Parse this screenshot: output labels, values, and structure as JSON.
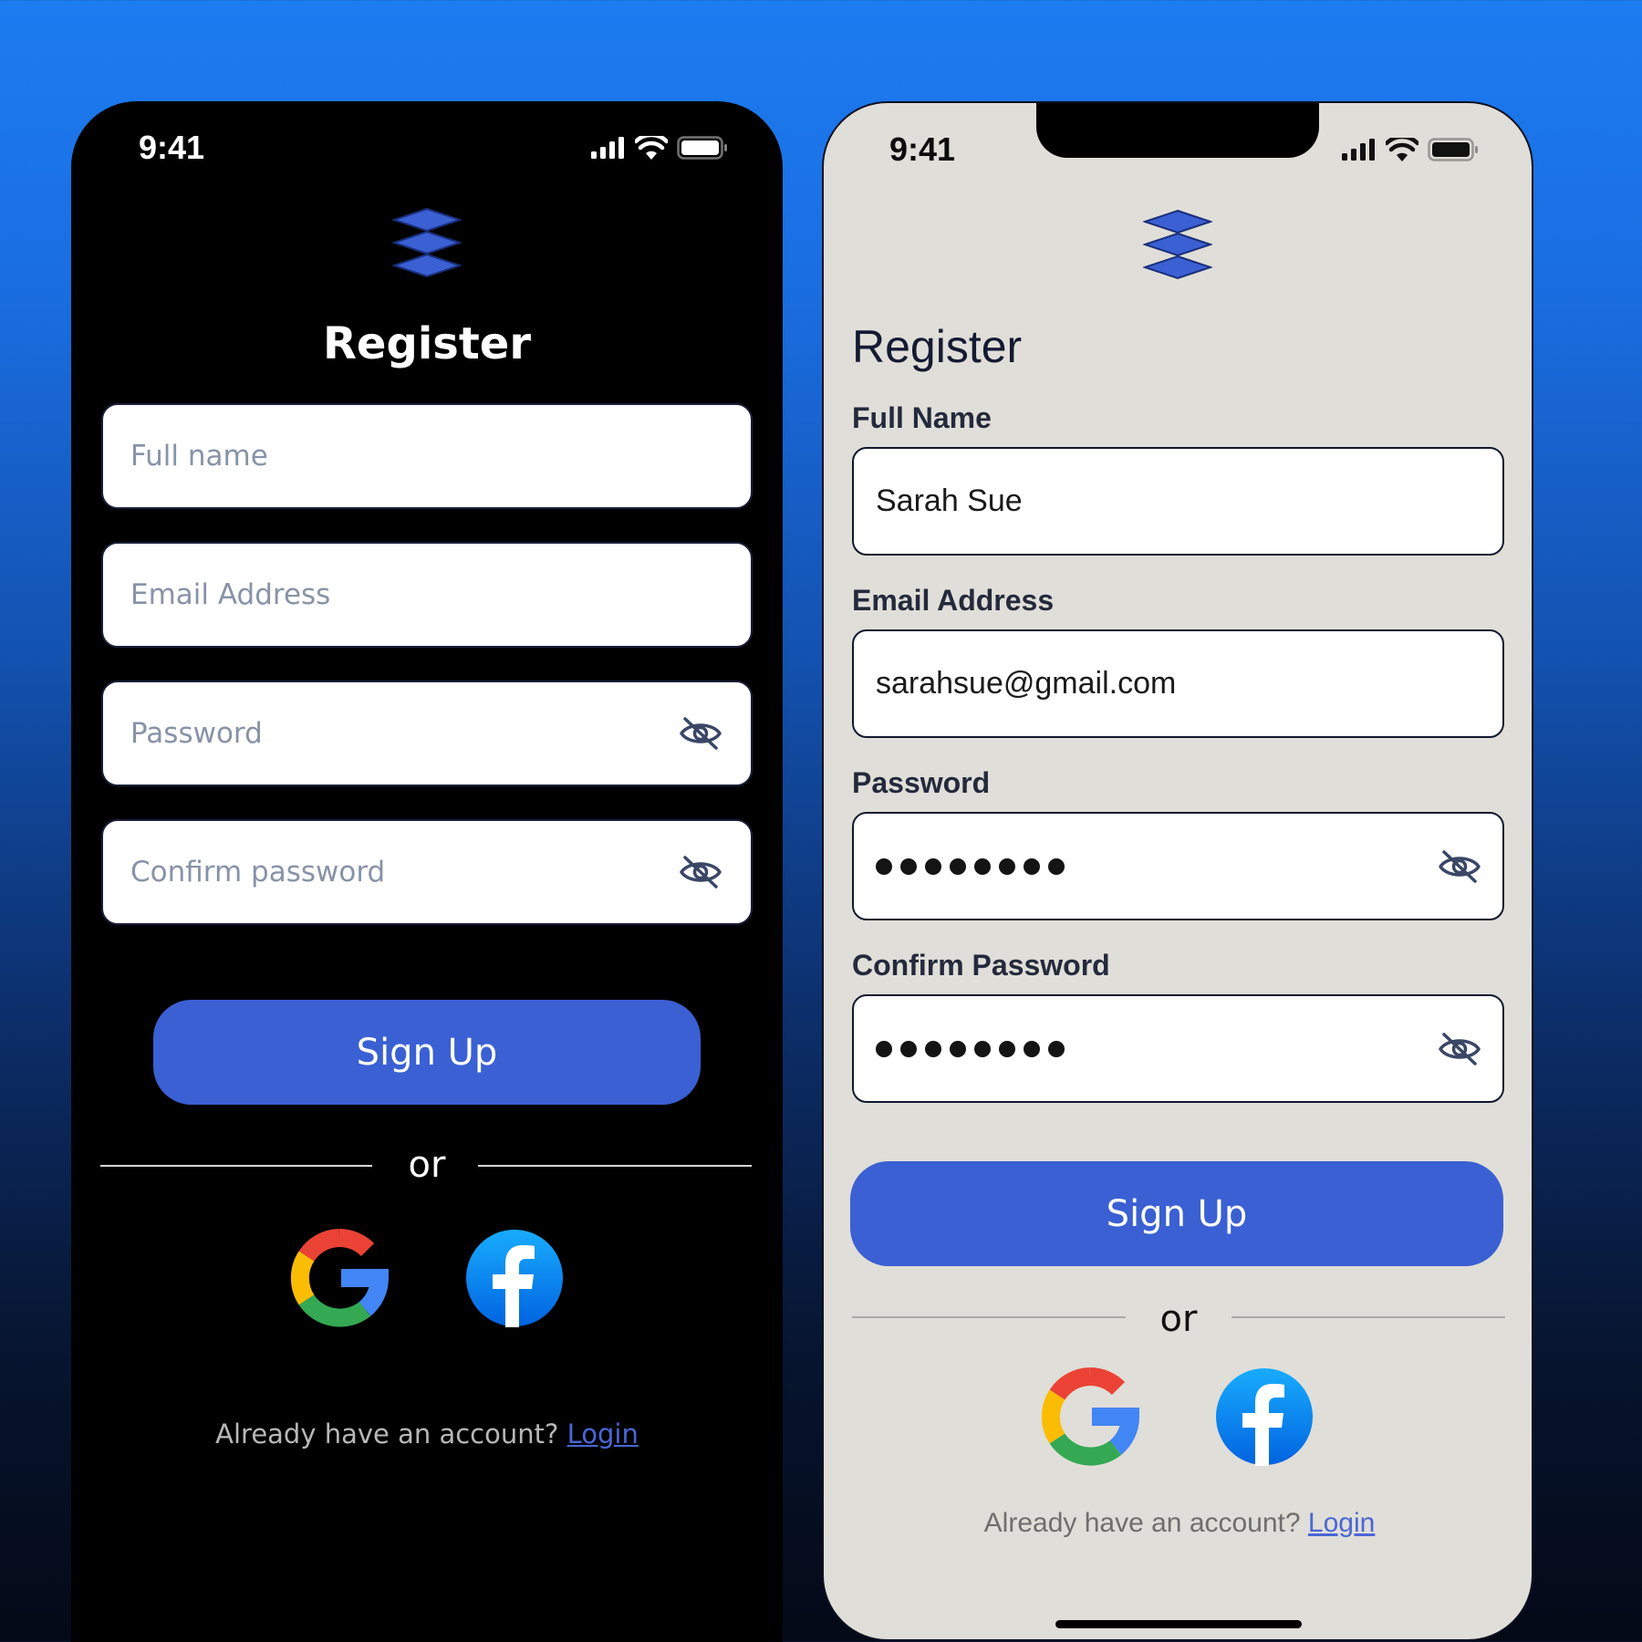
{
  "colors": {
    "accent": "#3a60d3",
    "dark_bg": "#000000",
    "light_bg": "#e0ded8",
    "link": "#4a66d6",
    "placeholder": "#8793a7"
  },
  "status_bar": {
    "time": "9:41",
    "icons": [
      "signal-icon",
      "wifi-icon",
      "battery-icon"
    ]
  },
  "dark_screen": {
    "logo": "layers-icon",
    "title": "Register",
    "fields": [
      {
        "placeholder": "Full name"
      },
      {
        "placeholder": "Email Address"
      },
      {
        "placeholder": "Password",
        "icon": "eye-off-icon"
      },
      {
        "placeholder": "Confirm password",
        "icon": "eye-off-icon"
      }
    ],
    "signup_label": "Sign Up",
    "or_label": "or",
    "social": [
      "google-icon",
      "facebook-icon"
    ],
    "footer_prompt": "Already have an account?",
    "login_label": "Login"
  },
  "light_screen": {
    "logo": "layers-icon",
    "title": "Register",
    "fields": [
      {
        "label": "Full Name",
        "value": "Sarah Sue"
      },
      {
        "label": "Email Address",
        "value": "sarahsue@gmail.com"
      },
      {
        "label": "Password",
        "masked_length": 8,
        "icon": "eye-off-icon"
      },
      {
        "label": "Confirm Password",
        "masked_length": 8,
        "icon": "eye-off-icon"
      }
    ],
    "signup_label": "Sign Up",
    "or_label": "or",
    "social": [
      "google-icon",
      "facebook-icon"
    ],
    "footer_prompt": "Already have an account?",
    "login_label": "Login"
  }
}
